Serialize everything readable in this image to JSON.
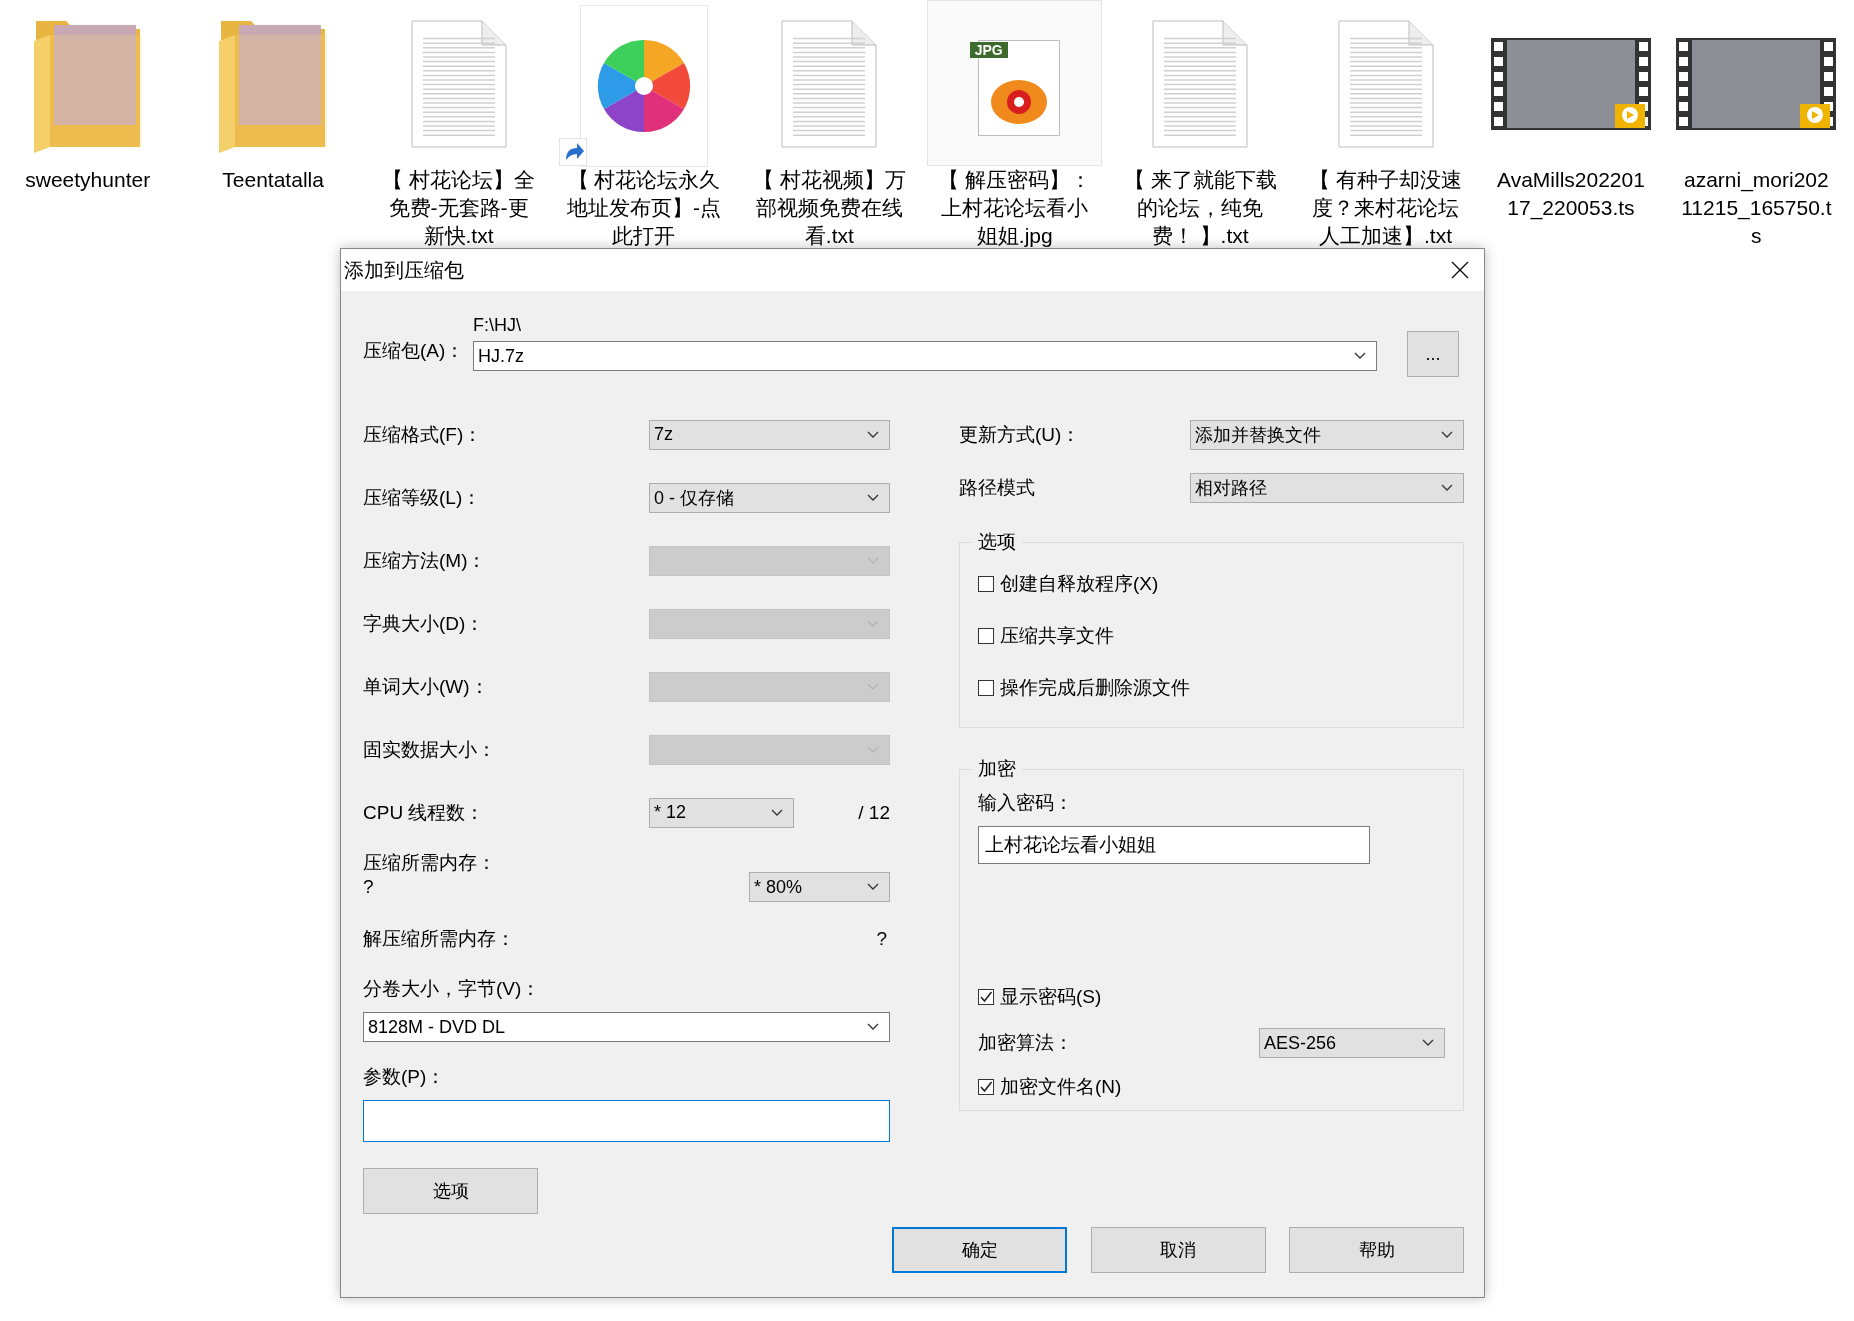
{
  "desktop_icons": [
    {
      "kind": "folder",
      "label": "sweetyhunter",
      "selected": false
    },
    {
      "kind": "folder",
      "label": "Teentatalla",
      "selected": false
    },
    {
      "kind": "text",
      "label": "【 村花论坛】全免费-无套路-更新快.txt",
      "selected": false
    },
    {
      "kind": "shortcut",
      "label": "【 村花论坛永久地址发布页】-点此打开",
      "selected": false
    },
    {
      "kind": "text",
      "label": "【 村花视频】万部视频免费在线看.txt",
      "selected": false
    },
    {
      "kind": "image",
      "label": "【 解压密码】：上村花论坛看小姐姐.jpg",
      "badge": "JPG",
      "selected": true
    },
    {
      "kind": "text",
      "label": "【 来了就能下载的论坛，纯免费！ 】.txt",
      "selected": false
    },
    {
      "kind": "text",
      "label": "【 有种子却没速度？来村花论坛人工加速】.txt",
      "selected": false
    },
    {
      "kind": "video",
      "label": "AvaMills20220117_220053.ts",
      "selected": false
    },
    {
      "kind": "video",
      "label": "azarni_mori20211215_165750.ts",
      "selected": false
    }
  ],
  "dialog": {
    "title": "添加到压缩包",
    "archive": {
      "label": "压缩包(A)：",
      "path": "F:\\HJ\\",
      "value": "HJ.7z",
      "browse": "..."
    },
    "left_rows": [
      {
        "kind": "combo",
        "label": "压缩格式(F)：",
        "value": "7z",
        "disabled": false
      },
      {
        "kind": "combo",
        "label": "压缩等级(L)：",
        "value": "0 - 仅存储",
        "disabled": false
      },
      {
        "kind": "combo",
        "label": "压缩方法(M)：",
        "disabled": true
      },
      {
        "kind": "combo",
        "label": "字典大小(D)：",
        "disabled": true
      },
      {
        "kind": "combo",
        "label": "单词大小(W)：",
        "disabled": true
      },
      {
        "kind": "combo",
        "label": "固实数据大小：",
        "disabled": true
      },
      {
        "kind": "threads",
        "label": "CPU 线程数：",
        "value": "* 12",
        "disabled": false,
        "total": "/ 12"
      },
      {
        "kind": "memory",
        "label": "压缩所需内存：",
        "note": "?",
        "value": "* 80%",
        "disabled": false
      },
      {
        "kind": "info",
        "label": "解压缩所需内存：",
        "note": "?"
      }
    ],
    "volume": {
      "label": "分卷大小，字节(V)：",
      "value": "8128M - DVD DL"
    },
    "parameters": {
      "label": "参数(P)："
    },
    "options_button": "选项",
    "update_mode": {
      "label": "更新方式(U)：",
      "value": "添加并替换文件"
    },
    "path_mode": {
      "label": "路径模式",
      "value": "相对路径"
    },
    "options_group": {
      "title": "选项",
      "checkboxes": [
        {
          "label": "创建自释放程序(X)",
          "checked": false
        },
        {
          "label": "压缩共享文件",
          "checked": false
        },
        {
          "label": "操作完成后删除源文件",
          "checked": false
        }
      ]
    },
    "encryption": {
      "title": "加密",
      "password_label": "输入密码：",
      "password": "上村花论坛看小姐姐",
      "show_password": {
        "label": "显示密码(S)",
        "checked": true
      },
      "method_label": "加密算法：",
      "method": "AES-256",
      "encrypt_names": {
        "label": "加密文件名(N)",
        "checked": true
      }
    },
    "buttons": [
      {
        "label": "确定",
        "default": true
      },
      {
        "label": "取消",
        "default": false
      },
      {
        "label": "帮助",
        "default": false
      }
    ]
  }
}
